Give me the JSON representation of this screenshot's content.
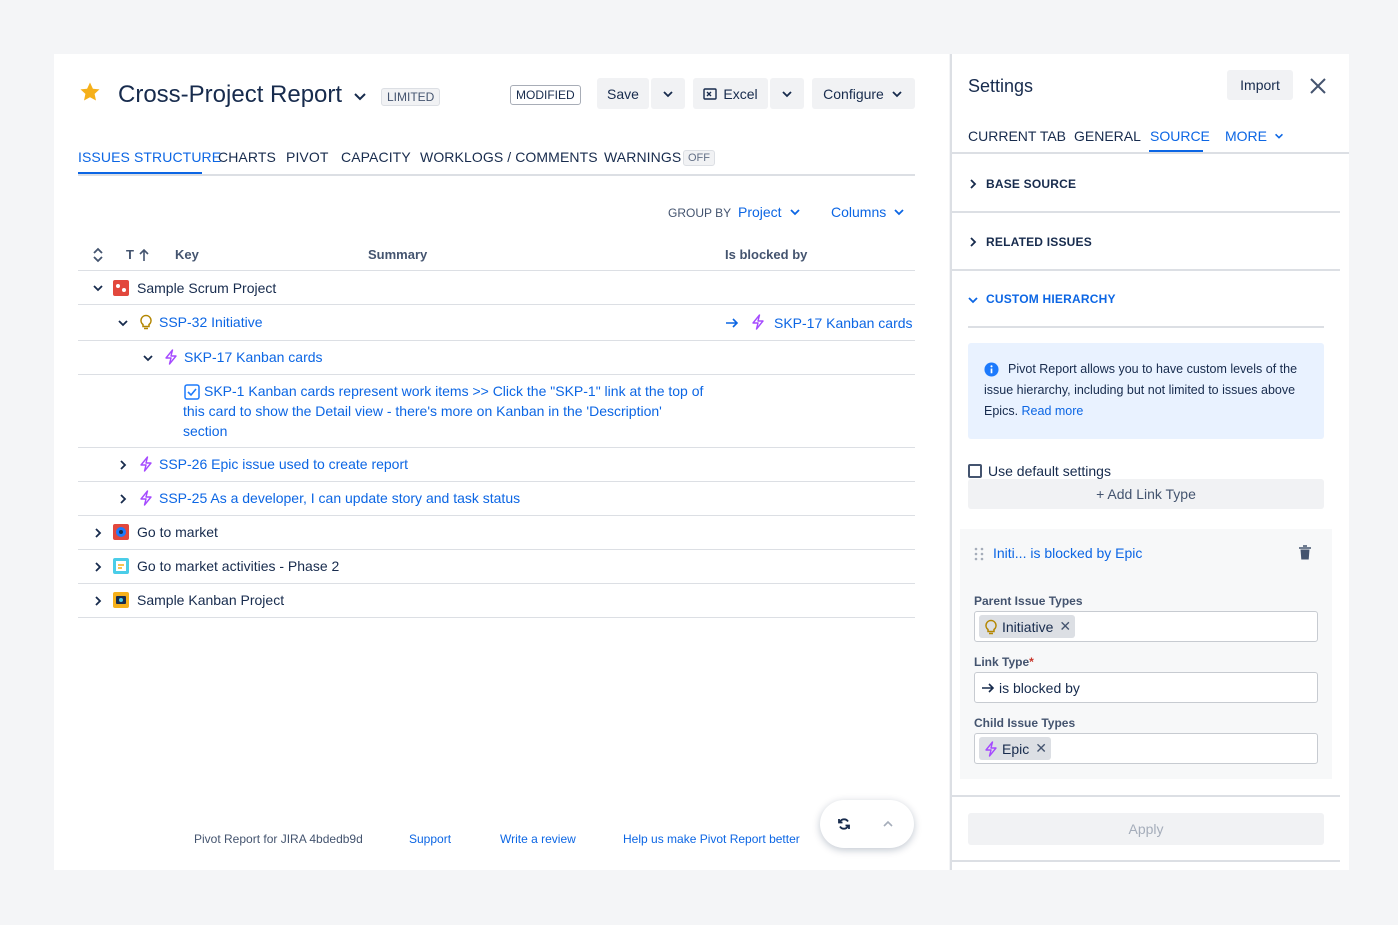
{
  "header": {
    "title": "Cross-Project Report",
    "limited_badge": "LIMITED",
    "modified_badge": "MODIFIED",
    "save_label": "Save",
    "excel_label": "Excel",
    "configure_label": "Configure"
  },
  "tabs": [
    {
      "label": "ISSUES STRUCTURE",
      "active": true
    },
    {
      "label": "CHARTS"
    },
    {
      "label": "PIVOT"
    },
    {
      "label": "CAPACITY"
    },
    {
      "label": "WORKLOGS / COMMENTS"
    },
    {
      "label": "WARNINGS",
      "badge": "OFF"
    }
  ],
  "toolbar": {
    "group_by_label": "GROUP BY",
    "group_by_value": "Project",
    "columns_label": "Columns"
  },
  "table": {
    "headers": {
      "type": "T",
      "key": "Key",
      "summary": "Summary",
      "blocked": "Is blocked by"
    },
    "rows": [
      {
        "text": "Sample Scrum Project",
        "icon": "project-scrum-icon",
        "expanded": true
      },
      {
        "text": "SSP-32 Initiative",
        "icon": "initiative-icon",
        "expanded": true,
        "blocked_by": "SKP-17 Kanban cards"
      },
      {
        "text": "SKP-17 Kanban cards",
        "icon": "epic-icon",
        "expanded": true
      },
      {
        "line1": "SKP-1 Kanban cards represent work items >> Click the \"SKP-1\" link at the top of",
        "line2": "this card to show the Detail view - there's more on Kanban in the 'Description'",
        "line3": "section",
        "icon": "task-icon"
      },
      {
        "text": "SSP-26 Epic issue used to create report",
        "icon": "epic-icon"
      },
      {
        "text": "SSP-25 As a developer, I can update story and task status",
        "icon": "epic-icon"
      },
      {
        "text": "Go to market",
        "icon": "project-icon"
      },
      {
        "text": "Go to market activities - Phase 2",
        "icon": "project-icon"
      },
      {
        "text": "Sample Kanban Project",
        "icon": "project-icon"
      }
    ]
  },
  "footer": {
    "version": "Pivot Report for JIRA 4bdedb9d",
    "support": "Support",
    "review": "Write a review",
    "feedback": "Help us make Pivot Report better"
  },
  "settings": {
    "title": "Settings",
    "import_label": "Import",
    "tabs": [
      "CURRENT TAB",
      "GENERAL",
      "SOURCE",
      "MORE"
    ],
    "active_tab": "SOURCE",
    "sections": {
      "base_source": "BASE SOURCE",
      "related_issues": "RELATED ISSUES",
      "custom_hierarchy": "CUSTOM HIERARCHY"
    },
    "info_text": "Pivot Report allows you to have custom levels of the issue hierarchy, including but not limited to issues above Epics.",
    "info_link": "Read more",
    "use_default": "Use default settings",
    "add_link_type": "+ Add Link Type",
    "link_card": {
      "title": "Initi... is blocked by Epic",
      "parent_label": "Parent Issue Types",
      "parent_value": "Initiative",
      "link_label": "Link Type",
      "link_required": "*",
      "link_value": "is blocked by",
      "child_label": "Child Issue Types",
      "child_value": "Epic"
    },
    "apply_label": "Apply"
  },
  "colors": {
    "accent": "#0c66e4",
    "star": "#f5b01a",
    "epic": "#a54aff",
    "initiative": "#b38600"
  }
}
